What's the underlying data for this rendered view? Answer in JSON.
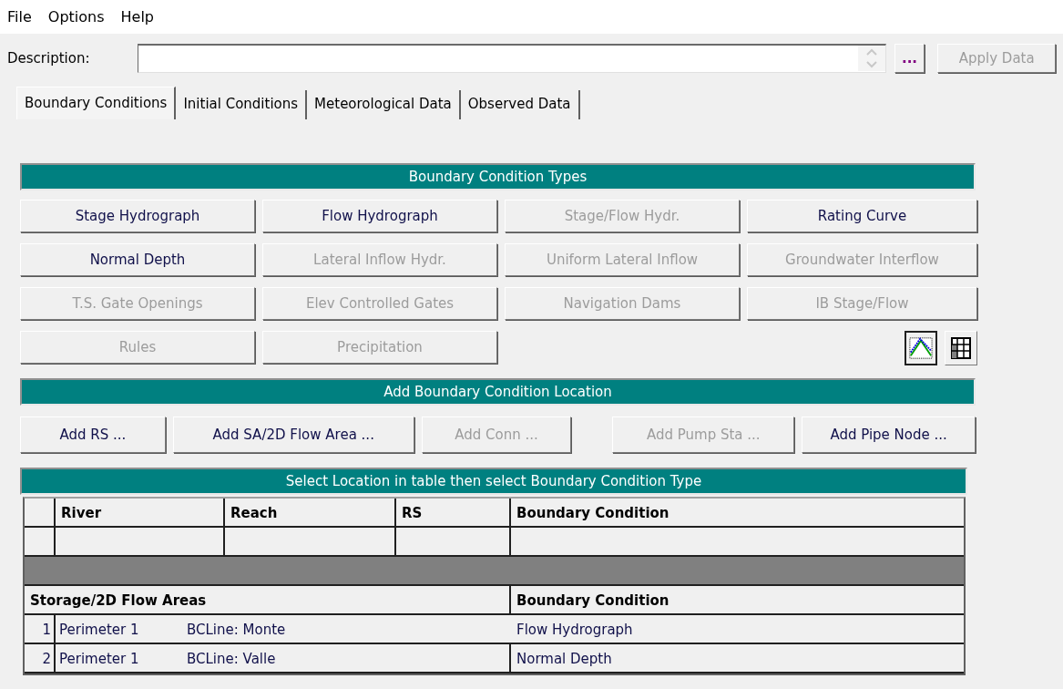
{
  "menu": [
    {
      "label": "File"
    },
    {
      "label": "Options"
    },
    {
      "label": "Help"
    }
  ],
  "description": {
    "label": "Description:",
    "browse_button": "...",
    "apply_button": {
      "label": "Apply Data",
      "disabled": true
    }
  },
  "tabs": [
    {
      "label": "Boundary Conditions",
      "selected": true
    },
    {
      "label": "Initial Conditions",
      "selected": false
    },
    {
      "label": "Meteorological Data",
      "selected": false
    },
    {
      "label": "Observed Data",
      "selected": false
    }
  ],
  "bc_types": {
    "title": "Boundary Condition Types",
    "buttons": [
      {
        "label": "Stage Hydrograph",
        "disabled": false
      },
      {
        "label": "Flow Hydrograph",
        "disabled": false
      },
      {
        "label": "Stage/Flow Hydr.",
        "disabled": true
      },
      {
        "label": "Rating Curve",
        "disabled": false
      },
      {
        "label": "Normal Depth",
        "disabled": false
      },
      {
        "label": "Lateral Inflow Hydr.",
        "disabled": true
      },
      {
        "label": "Uniform Lateral Inflow",
        "disabled": true
      },
      {
        "label": "Groundwater Interflow",
        "disabled": true
      },
      {
        "label": "T.S. Gate Openings",
        "disabled": true
      },
      {
        "label": "Elev Controlled Gates",
        "disabled": true
      },
      {
        "label": "Navigation Dams",
        "disabled": true
      },
      {
        "label": "IB Stage/Flow",
        "disabled": true
      },
      {
        "label": "Rules",
        "disabled": true
      },
      {
        "label": "Precipitation",
        "disabled": true
      }
    ],
    "view_toggles": [
      {
        "kind": "plot",
        "selected": true
      },
      {
        "kind": "table",
        "selected": false
      }
    ]
  },
  "add_location": {
    "title": "Add Boundary Condition Location",
    "buttons": [
      {
        "label": "Add RS ...",
        "disabled": false
      },
      {
        "label": "Add SA/2D Flow Area ...",
        "disabled": false
      },
      {
        "label": "Add Conn ...",
        "disabled": true
      },
      {
        "label": "Add Pump Sta ...",
        "disabled": true
      },
      {
        "label": "Add Pipe Node ...",
        "disabled": false
      }
    ]
  },
  "location_table": {
    "title": "Select Location in table then select Boundary Condition Type",
    "columns": [
      "River",
      "Reach",
      "RS",
      "Boundary Condition"
    ],
    "storage_columns": [
      "Storage/2D Flow Areas",
      "Boundary Condition"
    ],
    "storage_rows": [
      {
        "number": "1",
        "area": "Perimeter 1",
        "line": "BCLine: Monte",
        "boundary_condition": "Flow Hydrograph"
      },
      {
        "number": "2",
        "area": "Perimeter 1",
        "line": "BCLine: Valle",
        "boundary_condition": "Normal Depth"
      }
    ]
  }
}
